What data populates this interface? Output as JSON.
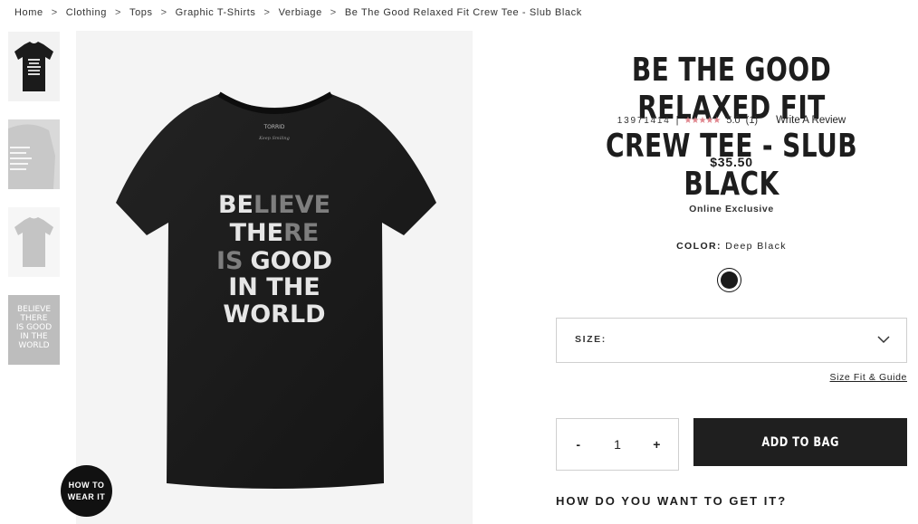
{
  "breadcrumb": {
    "items": [
      "Home",
      "Clothing",
      "Tops",
      "Graphic T-Shirts",
      "Verbiage",
      "Be The Good Relaxed Fit Crew Tee - Slub Black"
    ],
    "separator": ">"
  },
  "product": {
    "title": "BE THE GOOD RELAXED FIT CREW TEE - SLUB BLACK",
    "sku": "13971414",
    "rating_stars": "★★★★★",
    "rating_value": "5.0",
    "review_count": "(1)",
    "write_review": "Write A Review",
    "price": "$35.50",
    "badge": "Online Exclusive",
    "color_label": "COLOR:",
    "color_value": "Deep Black",
    "size_label": "SIZE:",
    "size_guide": "Size Fit & Guide",
    "quantity": "1",
    "qty_minus": "-",
    "qty_plus": "+",
    "add_to_bag": "ADD TO BAG",
    "delivery_heading": "HOW DO YOU WANT TO GET IT?"
  },
  "how_to_wear": {
    "line1": "HOW TO",
    "line2": "WEAR IT"
  },
  "shirt_graphic": {
    "line1_bold": "BE",
    "line1_light": "LIEVE",
    "line2_bold": "THE",
    "line2_light": "RE",
    "line3_light": "IS",
    "line3_bold": "GOOD",
    "line4": "IN THE",
    "line5": "WORLD"
  },
  "colors": {
    "accent_star": "#e0868e",
    "button_bg": "#1f1f1f",
    "swatch": "#1a1a1a"
  }
}
